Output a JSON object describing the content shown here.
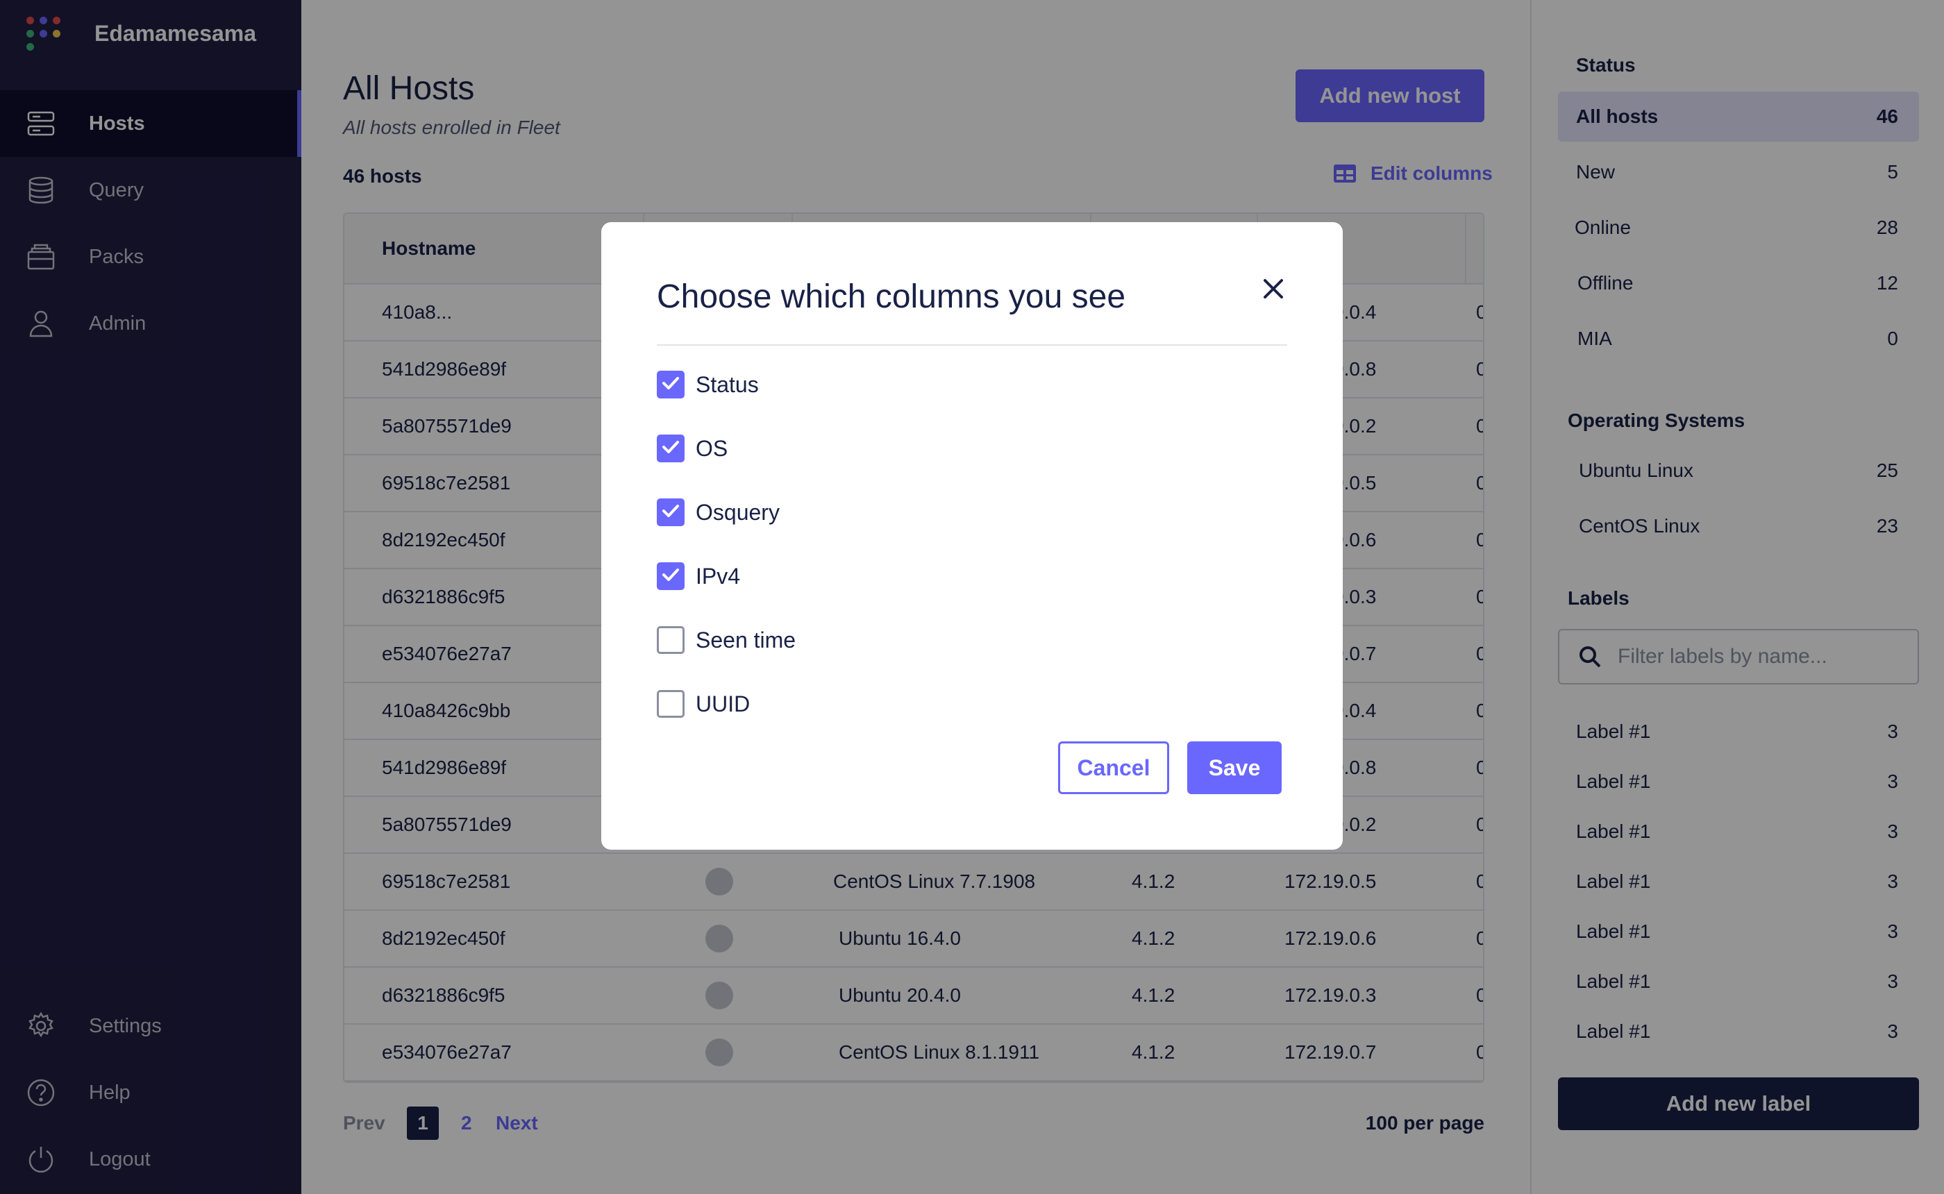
{
  "app": {
    "name": "Edamamesama",
    "logo_dots": [
      "#e24a4a",
      "#6a67fe",
      "#e24a4a",
      "#3db67b",
      "#6a67fe",
      "#f2c94c",
      "#3db67b",
      "#6a67fe",
      "#e24a4a"
    ]
  },
  "colors": {
    "sidebar": "#201e43",
    "accent": "#6a67fe",
    "dark_button": "#192147",
    "text": "#192147"
  },
  "sidebar": {
    "items": [
      {
        "label": "Hosts",
        "icon": "hosts-icon",
        "active": true
      },
      {
        "label": "Query",
        "icon": "database-icon",
        "active": false
      },
      {
        "label": "Packs",
        "icon": "packs-icon",
        "active": false
      },
      {
        "label": "Admin",
        "icon": "user-icon",
        "active": false
      }
    ],
    "bottom_items": [
      {
        "label": "Settings",
        "icon": "gear-icon"
      },
      {
        "label": "Help",
        "icon": "help-icon"
      },
      {
        "label": "Logout",
        "icon": "power-icon"
      }
    ]
  },
  "main": {
    "title": "All Hosts",
    "subtitle": "All hosts enrolled in Fleet",
    "add_host_label": "Add new host",
    "host_count": "46 hosts",
    "edit_columns_label": "Edit columns",
    "table": {
      "columns": [
        "Hostname",
        "",
        "",
        "",
        "",
        ""
      ],
      "rows": [
        {
          "hostname": "410a8...",
          "os": "",
          "osquery": "",
          "ip": "172.19.0.4",
          "extra": "0"
        },
        {
          "hostname": "541d2986e89f",
          "os": "",
          "osquery": "",
          "ip": "172.19.0.8",
          "extra": "0"
        },
        {
          "hostname": "5a8075571de9",
          "os": "",
          "osquery": "",
          "ip": "172.19.0.2",
          "extra": "0"
        },
        {
          "hostname": "69518c7e2581",
          "os": "",
          "osquery": "",
          "ip": "172.19.0.5",
          "extra": "0"
        },
        {
          "hostname": "8d2192ec450f",
          "os": "",
          "osquery": "",
          "ip": "172.19.0.6",
          "extra": "0"
        },
        {
          "hostname": "d6321886c9f5",
          "os": "",
          "osquery": "",
          "ip": "172.19.0.3",
          "extra": "0"
        },
        {
          "hostname": "e534076e27a7",
          "os": "",
          "osquery": "",
          "ip": "172.19.0.7",
          "extra": "0"
        },
        {
          "hostname": "410a8426c9bb",
          "os": "",
          "osquery": "",
          "ip": "172.19.0.4",
          "extra": "0"
        },
        {
          "hostname": "541d2986e89f",
          "os": "",
          "osquery": "",
          "ip": "172.19.0.8",
          "extra": "0"
        },
        {
          "hostname": "5a8075571de9",
          "os": "",
          "osquery": "",
          "ip": "172.19.0.2",
          "extra": "0"
        },
        {
          "hostname": "69518c7e2581",
          "os": "CentOS Linux 7.7.1908",
          "osquery": "4.1.2",
          "ip": "172.19.0.5",
          "extra": "0"
        },
        {
          "hostname": "8d2192ec450f",
          "os": "Ubuntu 16.4.0",
          "osquery": "4.1.2",
          "ip": "172.19.0.6",
          "extra": "0"
        },
        {
          "hostname": "d6321886c9f5",
          "os": "Ubuntu 20.4.0",
          "osquery": "4.1.2",
          "ip": "172.19.0.3",
          "extra": "0"
        },
        {
          "hostname": "e534076e27a7",
          "os": "CentOS Linux 8.1.1911",
          "osquery": "4.1.2",
          "ip": "172.19.0.7",
          "extra": "0"
        }
      ]
    },
    "pagination": {
      "prev": "Prev",
      "pages": [
        "1",
        "2"
      ],
      "current": "1",
      "next": "Next",
      "per_page": "100 per page"
    }
  },
  "right_panel": {
    "status_heading": "Status",
    "status": [
      {
        "label": "All hosts",
        "count": "46",
        "active": true
      },
      {
        "label": "New",
        "count": "5",
        "active": false
      },
      {
        "label": "Online",
        "count": "28",
        "active": false
      },
      {
        "label": "Offline",
        "count": "12",
        "active": false
      },
      {
        "label": "MIA",
        "count": "0",
        "active": false
      }
    ],
    "os_heading": "Operating Systems",
    "os": [
      {
        "label": "Ubuntu Linux",
        "count": "25"
      },
      {
        "label": "CentOS Linux",
        "count": "23"
      }
    ],
    "labels_heading": "Labels",
    "filter_placeholder": "Filter labels by name...",
    "labels": [
      {
        "label": "Label #1",
        "count": "3"
      },
      {
        "label": "Label #1",
        "count": "3"
      },
      {
        "label": "Label #1",
        "count": "3"
      },
      {
        "label": "Label #1",
        "count": "3"
      },
      {
        "label": "Label #1",
        "count": "3"
      },
      {
        "label": "Label #1",
        "count": "3"
      },
      {
        "label": "Label #1",
        "count": "3"
      }
    ],
    "add_label": "Add new label"
  },
  "modal": {
    "title": "Choose which columns you see",
    "options": [
      {
        "label": "Status",
        "checked": true
      },
      {
        "label": "OS",
        "checked": true
      },
      {
        "label": "Osquery",
        "checked": true
      },
      {
        "label": "IPv4",
        "checked": true
      },
      {
        "label": "Seen time",
        "checked": false
      },
      {
        "label": "UUID",
        "checked": false
      }
    ],
    "cancel_label": "Cancel",
    "save_label": "Save"
  }
}
